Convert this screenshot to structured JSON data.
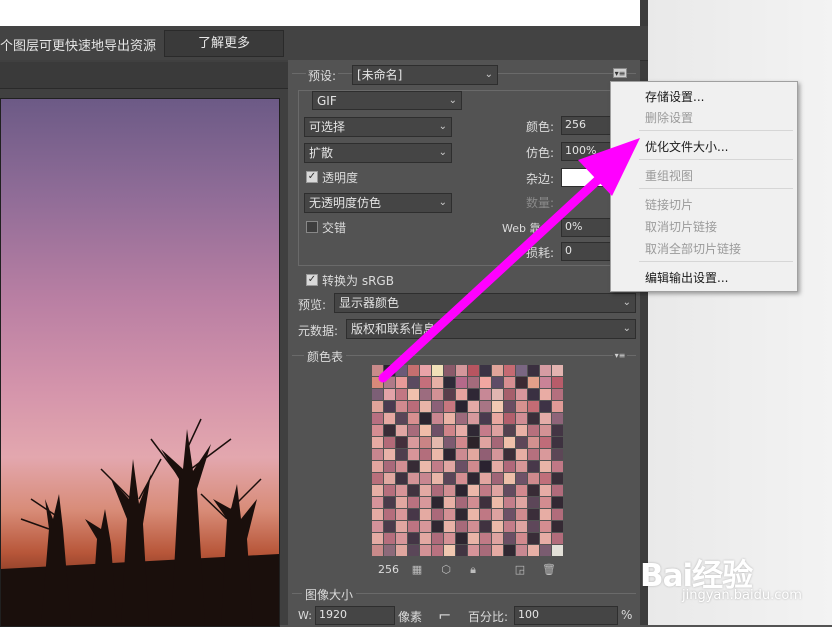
{
  "infobar": {
    "text": "个图层可更快速地导出资源",
    "learn_more": "了解更多"
  },
  "preset": {
    "label": "预设:",
    "value": "[未命名]"
  },
  "format": {
    "value": "GIF"
  },
  "reduction": {
    "value": "可选择"
  },
  "dither_algo": {
    "value": "扩散"
  },
  "transparency": {
    "label": "透明度",
    "checked": true
  },
  "transparency_dither": {
    "value": "无透明度仿色"
  },
  "interlaced": {
    "label": "交错",
    "checked": false
  },
  "colors": {
    "label": "颜色:",
    "value": "256"
  },
  "dither": {
    "label": "仿色:",
    "value": "100%"
  },
  "matte": {
    "label": "杂边:"
  },
  "amount": {
    "label": "数量:"
  },
  "websnap": {
    "label": "Web 靠",
    "value": "0%"
  },
  "lossy": {
    "label": "损耗:",
    "value": "0"
  },
  "convert_srgb": {
    "label": "转换为 sRGB",
    "checked": true
  },
  "preview": {
    "label": "预览:",
    "value": "显示器颜色"
  },
  "metadata": {
    "label": "元数据:",
    "value": "版权和联系信息"
  },
  "color_table": {
    "title": "颜色表",
    "count": "256",
    "colors": [
      "#c98a8a",
      "#2a2530",
      "#6b5a78",
      "#c56f6f",
      "#e9a3a8",
      "#f1e1b8",
      "#8a5a6a",
      "#d4979b",
      "#b75560",
      "#3b3344",
      "#e0a49a",
      "#c56a72",
      "#7a6682",
      "#3a2f3f",
      "#d69ca3",
      "#e3b3b0",
      "#d88a7a",
      "#b07a88",
      "#e79a99",
      "#5a4a60",
      "#c56f7b",
      "#e6b0a6",
      "#2f2a38",
      "#b4698a",
      "#a36b7c",
      "#f2a7a1",
      "#5f4c67",
      "#d78e91",
      "#3c2a33",
      "#e2a08a",
      "#c98397",
      "#b85c6a",
      "#7c5f76",
      "#e3a3a8",
      "#c27783",
      "#f0c0ad",
      "#9c6c7f",
      "#d39195",
      "#5a3d4b",
      "#e6a39f",
      "#2f2735",
      "#c78896",
      "#e1b6b1",
      "#a65f6b",
      "#d8969c",
      "#3a3042",
      "#e9aca4",
      "#b46f7e",
      "#e0a49a",
      "#4a3a50",
      "#d18a8f",
      "#b96c7a",
      "#e8b4a8",
      "#8c6078",
      "#c7777f",
      "#2a2431",
      "#e3a9a6",
      "#a87585",
      "#f2c8b2",
      "#6b4d62",
      "#d7918f",
      "#c46c74",
      "#3e3346",
      "#e09a96",
      "#b76f80",
      "#e6a8a2",
      "#5a4558",
      "#d88f90",
      "#2c2430",
      "#c98690",
      "#eab3a6",
      "#9d6a7c",
      "#d6999d",
      "#493a4e",
      "#e8a7a0",
      "#b25f6c",
      "#d08d94",
      "#3b2f3a",
      "#e4aca8",
      "#8e6479",
      "#d58d92",
      "#3a2c37",
      "#e2a6a4",
      "#a76b7b",
      "#f0bca9",
      "#6e5067",
      "#cf8489",
      "#e7aca7",
      "#2f2834",
      "#c57b8a",
      "#dea1a0",
      "#54414f",
      "#e9b1a6",
      "#b6707d",
      "#d49295",
      "#433544",
      "#e6aaa3",
      "#b26a78",
      "#452f3c",
      "#d99a9c",
      "#c98485",
      "#e4b9ad",
      "#7d5a70",
      "#d2888d",
      "#2c2329",
      "#e0a3a0",
      "#a66777",
      "#efc0aa",
      "#5e4658",
      "#d3918f",
      "#c06c79",
      "#3e3240",
      "#c8868f",
      "#e8b2a8",
      "#4f3e4e",
      "#d89599",
      "#b36e7c",
      "#ebb8a9",
      "#2e2531",
      "#cc8b91",
      "#e2a79f",
      "#915f74",
      "#d4969a",
      "#3c2e38",
      "#e7aea4",
      "#b5707e",
      "#d9999b",
      "#5c4656",
      "#e3a59f",
      "#a9697a",
      "#d38f93",
      "#372b35",
      "#ecb9aa",
      "#c27c88",
      "#e0a6a2",
      "#6a4f65",
      "#d08a8e",
      "#2b2330",
      "#e5aba4",
      "#b0687a",
      "#d79697",
      "#48384a",
      "#e9b4a7",
      "#c07885",
      "#b96f7b",
      "#e1a8a1",
      "#3f3240",
      "#d39396",
      "#c88690",
      "#e9b5a8",
      "#5a4558",
      "#d48e92",
      "#2e2632",
      "#e2a5a0",
      "#a06577",
      "#edbfa9",
      "#6f5268",
      "#cf8a8d",
      "#c06f7a",
      "#3a2e39",
      "#e7aea5",
      "#b66f7d",
      "#d79598",
      "#41333f",
      "#e3a9a3",
      "#ad6a7a",
      "#d08e92",
      "#2c2430",
      "#ebb7a9",
      "#c17a86",
      "#dfa4a1",
      "#634b5f",
      "#d2898e",
      "#392c36",
      "#e6aca5",
      "#b06b7b",
      "#d6939a",
      "#4a3a4a",
      "#e2a7a1",
      "#ba7280",
      "#d8989b",
      "#2d2530",
      "#e8b0a6",
      "#a66879",
      "#d18d92",
      "#3e303d",
      "#ecbaa8",
      "#c47e8a",
      "#e0a5a1",
      "#5c4658",
      "#d38c90",
      "#332833",
      "#e5aba3",
      "#b46d7c",
      "#d9979a",
      "#473748",
      "#e4aaa2",
      "#ab697a",
      "#d39094",
      "#2f2731",
      "#eab6a8",
      "#bf7884",
      "#dda2a0",
      "#6d5066",
      "#d08b8f",
      "#3b2e3a",
      "#e7ada4",
      "#b16c7b",
      "#d4929a",
      "#4b3b4b",
      "#e1a6a1",
      "#bd7482",
      "#d7979a",
      "#302832",
      "#e9b2a7",
      "#a76a7a",
      "#d28e93",
      "#403240",
      "#ebb9a9",
      "#c37d89",
      "#dfa4a1",
      "#5e475a",
      "#d48d91",
      "#352a34",
      "#e4aaa3",
      "#b56e7d",
      "#d8969a",
      "#443545",
      "#e3a8a2",
      "#ae6b7b",
      "#d49195",
      "#2e2630",
      "#e9b4a7",
      "#c07a86",
      "#dea3a0",
      "#6b4f64",
      "#d18a8e",
      "#392d38",
      "#e6aca5",
      "#b26c7b",
      "#c98a8a",
      "#8d6a7a",
      "#e0a69f",
      "#5a4658",
      "#d39296",
      "#b97280",
      "#f0c7b0",
      "#423542",
      "#d69499",
      "#a86b7a",
      "#e5aaa3",
      "#312832",
      "#c88891",
      "#e7b0a6",
      "#7a5c70",
      "#e3e0d8"
    ]
  },
  "image_size": {
    "title": "图像大小",
    "w_label": "W:",
    "w_value": "1920",
    "unit": "像素",
    "percent_label": "百分比:",
    "percent_value": "100",
    "percent_sign": "%"
  },
  "menu": {
    "items": [
      {
        "label": "存储设置...",
        "enabled": true
      },
      {
        "label": "删除设置",
        "enabled": false
      },
      {
        "label": "优化文件大小...",
        "enabled": true
      },
      {
        "label": "重组视图",
        "enabled": false
      },
      {
        "label": "链接切片",
        "enabled": false
      },
      {
        "label": "取消切片链接",
        "enabled": false
      },
      {
        "label": "取消全部切片链接",
        "enabled": false
      },
      {
        "label": "编辑输出设置...",
        "enabled": true
      }
    ]
  },
  "watermark": {
    "brand": "Bai经验",
    "url": "jingyan.baidu.com"
  },
  "colors_theme": {
    "arrow": "#ff00ff",
    "panel_bg": "#535353"
  }
}
